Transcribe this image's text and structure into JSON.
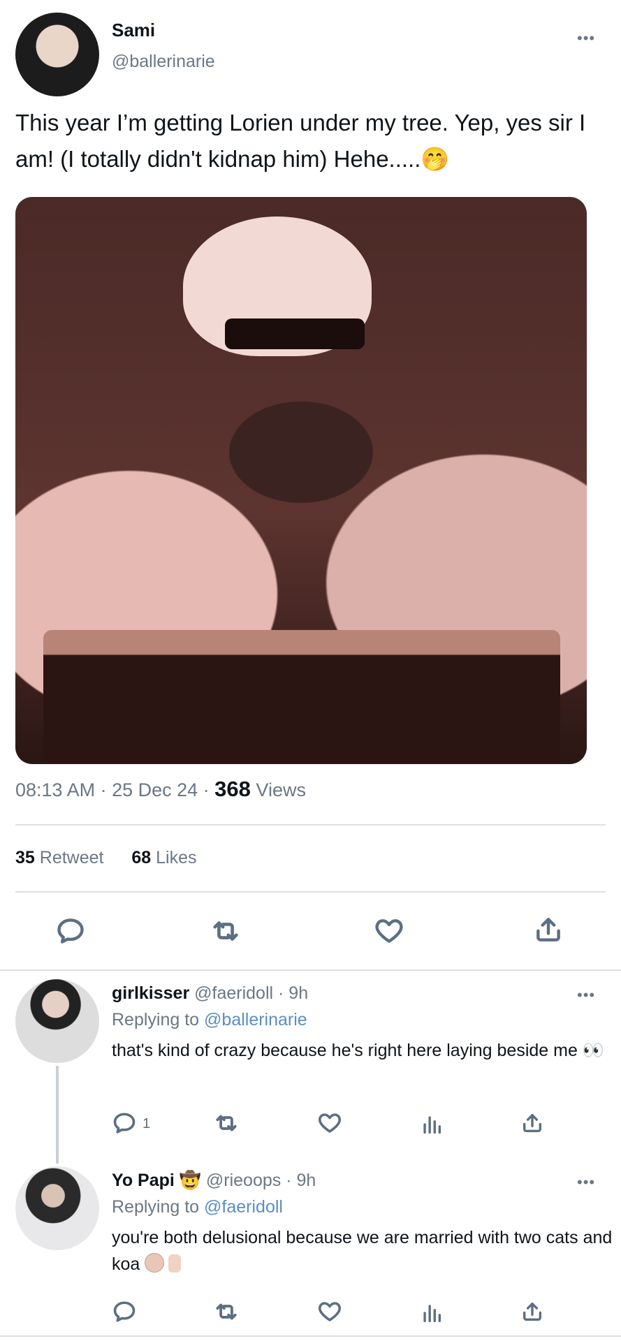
{
  "main_tweet": {
    "display_name": "Sami",
    "handle": "@ballerinarie",
    "more_label": "•••",
    "text": "This year I’m getting Lorien under my tree. Yep, yes sir I am! (I totally didn't kidnap him) Hehe.....",
    "text_emoji": "🤭",
    "time": "08:13 AM · 25 Dec 24 ·",
    "views_count": "368",
    "views_label": "Views",
    "retweet_count": "35",
    "retweet_label": "Retweet",
    "likes_count": "68",
    "likes_label": "Likes"
  },
  "replies": [
    {
      "display_name": "girlkisser",
      "handle": "@faeridoll · 9h",
      "replying_prefix": "Replying to",
      "replying_to": "@ballerinarie",
      "text": "that's kind of crazy because he's right here laying beside me 👀",
      "reply_count": "1",
      "more_label": "•••"
    },
    {
      "display_name": "Yo Papi",
      "name_emoji": "🤠",
      "handle": "@rieoops · 9h",
      "replying_prefix": "Replying to",
      "replying_to": "@faeridoll",
      "text": "you're both delusional because we are married with two cats and koa",
      "more_label": "•••"
    }
  ],
  "icons": {
    "reply": "reply-icon",
    "retweet": "retweet-icon",
    "like": "heart-icon",
    "share": "share-icon",
    "analytics": "analytics-icon",
    "more": "more-icon"
  },
  "colors": {
    "link": "#5b8ec1",
    "muted": "#6b7785",
    "icon": "#5c6e82",
    "divider": "#dcdfe3"
  }
}
